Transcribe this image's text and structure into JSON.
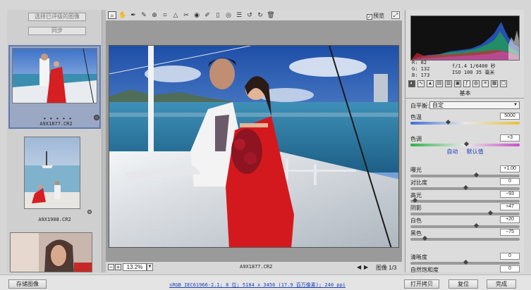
{
  "filmstrip": {
    "select_filtered_button": "选择已评级的图像",
    "sync_button": "同步",
    "thumbnails": [
      {
        "caption": "A9X1877.CR2",
        "selected": true
      },
      {
        "caption": "A9X1908.CR2",
        "selected": false
      },
      {
        "caption": "",
        "selected": false
      }
    ],
    "dots": "• • • • •"
  },
  "toolbar": {
    "tools": [
      "zoom-icon",
      "hand-icon",
      "white-balance-icon",
      "color-sampler-icon",
      "target-icon",
      "crop-icon",
      "straighten-icon",
      "spot-removal-icon",
      "red-eye-icon",
      "brush-icon",
      "graduated-filter-icon",
      "list-icon",
      "rotate-left-icon",
      "rotate-right-icon",
      "trash-icon"
    ],
    "preview_label": "预览",
    "preview_checked": "✓"
  },
  "statusbar": {
    "minus": "−",
    "plus": "+",
    "zoom": "13.2%",
    "filename": "A9X1877.CR2",
    "prev": "◀",
    "next": "▶",
    "image_count": "图像 1/3"
  },
  "info": {
    "r": "R:   82",
    "g": "G:  132",
    "b": "B:  173",
    "aperture": "f/1.4   1/6400 秒",
    "iso": "ISO 100   35 毫米"
  },
  "panel": {
    "section_title": "基本",
    "white_balance_label": "白平衡:",
    "white_balance_value": "自定",
    "auto": "自动",
    "default": "默认值",
    "sliders": [
      {
        "label": "色温",
        "value": "5000",
        "pos": 0.34
      },
      {
        "label": "色调",
        "value": "+3",
        "pos": 0.51
      },
      {
        "label": "曝光",
        "value": "+1.00",
        "pos": 0.6
      },
      {
        "label": "对比度",
        "value": "0",
        "pos": 0.5
      },
      {
        "label": "高光",
        "value": "−93",
        "pos": 0.04
      },
      {
        "label": "阴影",
        "value": "+47",
        "pos": 0.73
      },
      {
        "label": "白色",
        "value": "+20",
        "pos": 0.6
      },
      {
        "label": "黑色",
        "value": "−75",
        "pos": 0.13
      },
      {
        "label": "清晰度",
        "value": "0",
        "pos": 0.5
      },
      {
        "label": "自然饱和度",
        "value": "0",
        "pos": 0.5
      }
    ]
  },
  "bottom": {
    "save": "存储图像",
    "workflow": "sRGB IEC61966-2.1; 8 位; 5184 x 3456 (17.9 百万像素); 240 ppi",
    "open": "打开拷贝",
    "reset": "复位",
    "done": "完成"
  }
}
